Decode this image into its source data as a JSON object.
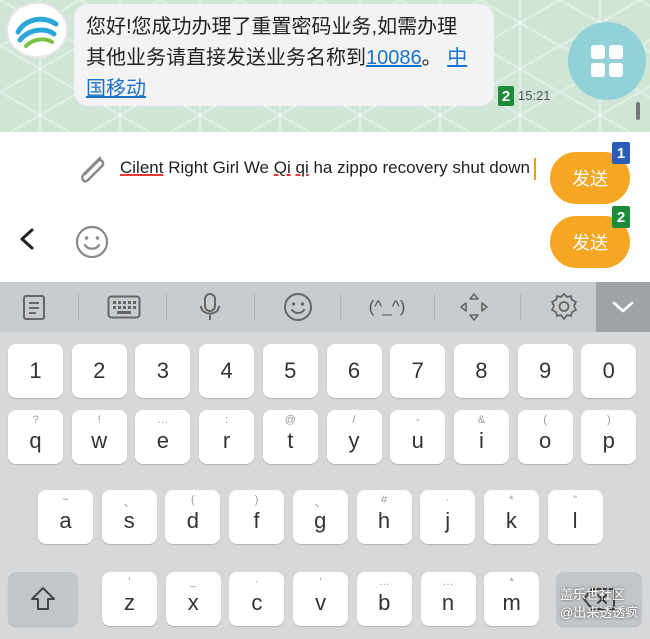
{
  "chat": {
    "message_line1": "您好!您成功办理了重置密码业务,如需办理",
    "message_line2_prefix": "其他业务请直接发送业务名称到",
    "message_number_link": "10086",
    "message_line2_punct": "。",
    "message_link_part1": "中",
    "message_link_part2": "国移动",
    "sim_badge": "2",
    "time": "15:21"
  },
  "compose": {
    "words": [
      "Cilent",
      "Right",
      "Girl",
      "We",
      "Qi",
      "qi",
      "ha",
      "zippo",
      "recovery",
      "shut",
      "down"
    ],
    "error_words": [
      "Cilent",
      "Qi",
      "qi"
    ],
    "send_button_1": "发送",
    "send_button_2": "发送",
    "send_badge_1": "1",
    "send_badge_2": "2"
  },
  "toolbar": {
    "items": [
      "clipboard-icon",
      "keyboard-icon",
      "microphone-icon",
      "emoji-icon",
      "kaomoji",
      "cursor-move-icon",
      "settings-icon",
      "collapse-icon"
    ],
    "kaomoji_label": "(^_^)"
  },
  "keyboard": {
    "number_row": [
      "1",
      "2",
      "3",
      "4",
      "5",
      "6",
      "7",
      "8",
      "9",
      "0"
    ],
    "row1": [
      {
        "key": "q",
        "hint": "?"
      },
      {
        "key": "w",
        "hint": "!"
      },
      {
        "key": "e",
        "hint": "…"
      },
      {
        "key": "r",
        "hint": ":"
      },
      {
        "key": "t",
        "hint": "@"
      },
      {
        "key": "y",
        "hint": "/"
      },
      {
        "key": "u",
        "hint": "-"
      },
      {
        "key": "i",
        "hint": "&"
      },
      {
        "key": "o",
        "hint": "("
      },
      {
        "key": "p",
        "hint": ")"
      }
    ],
    "row2": [
      {
        "key": "a",
        "hint": "~"
      },
      {
        "key": "s",
        "hint": "、"
      },
      {
        "key": "d",
        "hint": "("
      },
      {
        "key": "f",
        "hint": ")"
      },
      {
        "key": "g",
        "hint": "、"
      },
      {
        "key": "h",
        "hint": "#"
      },
      {
        "key": "j",
        "hint": "·"
      },
      {
        "key": "k",
        "hint": "*"
      },
      {
        "key": "l",
        "hint": "\""
      }
    ],
    "row3": [
      {
        "key": "z",
        "hint": "'"
      },
      {
        "key": "x",
        "hint": "_"
      },
      {
        "key": "c",
        "hint": "·"
      },
      {
        "key": "v",
        "hint": "‘"
      },
      {
        "key": "b",
        "hint": "…"
      },
      {
        "key": "n",
        "hint": "…"
      },
      {
        "key": "m",
        "hint": "*"
      }
    ],
    "shift_icon": "shift-arrow-icon",
    "backspace_icon": "backspace-icon"
  },
  "watermark": {
    "line1": "盖乐世社区",
    "line2": "@出来透透疯"
  },
  "colors": {
    "send_button": "#f5a623",
    "link": "#1a73c8",
    "sim2": "#1f8a3a",
    "sim1": "#2b5db8",
    "caret": "#f39c12"
  }
}
